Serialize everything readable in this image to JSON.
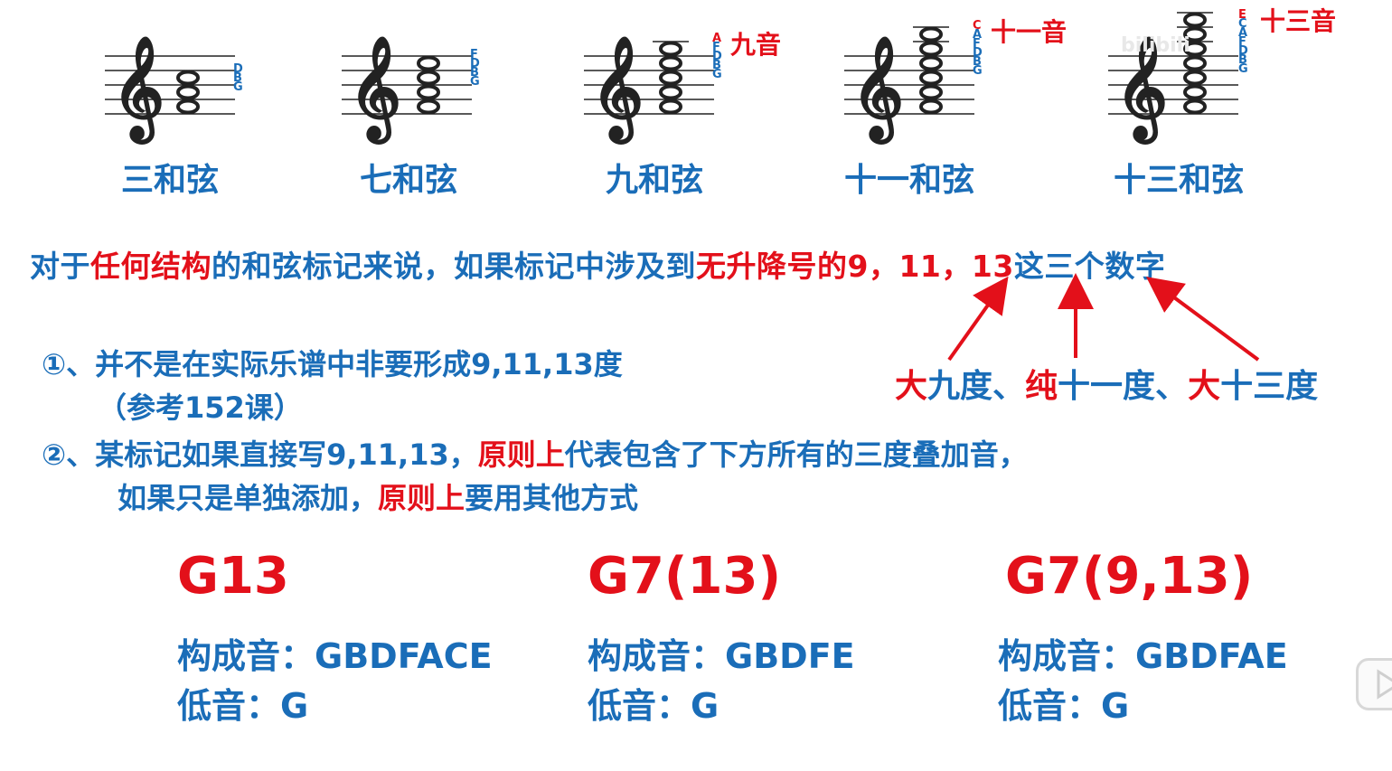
{
  "chords": [
    {
      "name": "三和弦",
      "letters": [
        "D",
        "B",
        "G"
      ],
      "tag": ""
    },
    {
      "name": "七和弦",
      "letters": [
        "F",
        "D",
        "B",
        "G"
      ],
      "tag": ""
    },
    {
      "name": "九和弦",
      "letters": [
        "A",
        "F",
        "D",
        "B",
        "G"
      ],
      "tag": "九音"
    },
    {
      "name": "十一和弦",
      "letters": [
        "C",
        "A",
        "F",
        "D",
        "B",
        "G"
      ],
      "tag": "十一音"
    },
    {
      "name": "十三和弦",
      "letters": [
        "E",
        "C",
        "A",
        "F",
        "D",
        "B",
        "G"
      ],
      "tag": "十三音"
    }
  ],
  "rule": {
    "p1": "对于",
    "p2": "任何结构",
    "p3": "的和弦标记来说，如果标记中涉及到",
    "p4": "无升降号",
    "p5": "的9，11，13",
    "p6": "这三个数字"
  },
  "degrees": {
    "d1a": "大",
    "d1b": "九度、",
    "d2a": "纯",
    "d2b": "十一度、",
    "d3a": "大",
    "d3b": "十三度"
  },
  "point1": {
    "line1": "①、并不是在实际乐谱中非要形成9,11,13度",
    "line2": "（参考152课）"
  },
  "point2": {
    "a": "②、某标记如果直接写9,11,13，",
    "b": "原则上",
    "c": "代表包含了下方所有的三度叠加音，",
    "d": "如果只是单独添加，",
    "e": "原则上",
    "f": "要用其他方式"
  },
  "examples": [
    {
      "title": "G13",
      "tones_label": "构成音：",
      "tones": "GBDFACE",
      "bass_label": "低音：",
      "bass": "G"
    },
    {
      "title": "G7(13)",
      "tones_label": "构成音：",
      "tones": "GBDFE",
      "bass_label": "低音：",
      "bass": "G"
    },
    {
      "title": "G7(9,13)",
      "tones_label": "构成音：",
      "tones": "GBDFAE",
      "bass_label": "低音：",
      "bass": "G"
    }
  ],
  "colors": {
    "blue": "#1a6db8",
    "red": "#e3101a"
  }
}
